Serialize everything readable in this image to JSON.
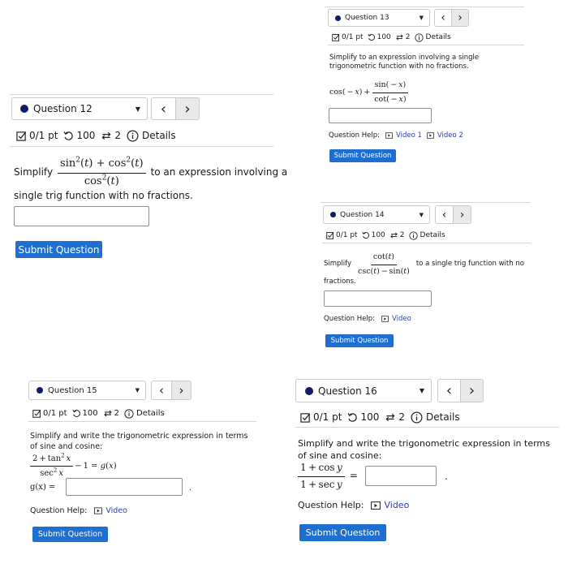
{
  "common": {
    "score": "0/1 pt",
    "retries": "100",
    "attempts": "2",
    "details": "Details",
    "submit": "Submit Question",
    "help_label": "Question Help:",
    "nav_prev": "‹",
    "nav_next": "›",
    "caret": "▼"
  },
  "q12": {
    "title": "Question 12",
    "prefix": "Simplify",
    "suffix": "to an expression involving a",
    "line2": "single trig function with no fractions."
  },
  "q13": {
    "title": "Question 13",
    "prompt": "Simplify to an expression involving a single trigonometric function with no fractions.",
    "video1": "Video 1",
    "video2": "Video 2"
  },
  "q14": {
    "title": "Question 14",
    "prefix": "Simplify",
    "suffix": "to a single trig function with no",
    "line2": "fractions.",
    "video": "Video"
  },
  "q15": {
    "title": "Question 15",
    "prompt": "Simplify and write the trigonometric expression in terms of sine and cosine:",
    "gx_label": "g(x) =",
    "period": ".",
    "video": "Video"
  },
  "q16": {
    "title": "Question 16",
    "prompt": "Simplify and write the trigonometric expression in terms of sine and cosine:",
    "period": ".",
    "video": "Video"
  }
}
